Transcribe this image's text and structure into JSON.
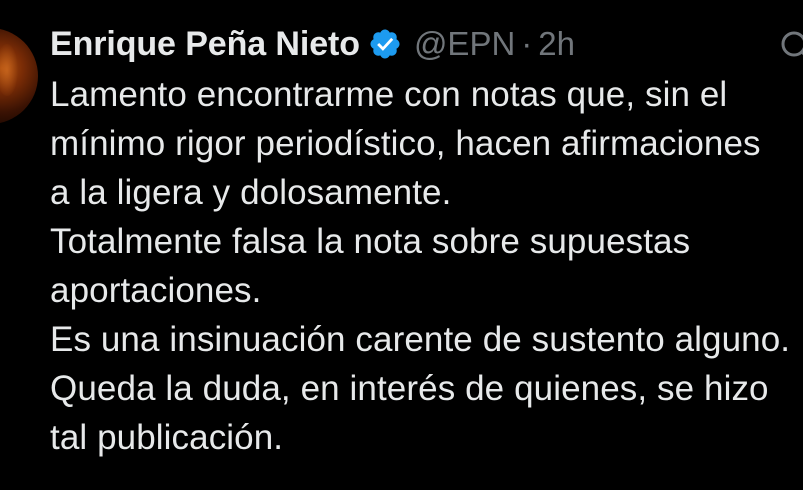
{
  "tweet": {
    "author": {
      "name": "Enrique Peña Nieto",
      "handle": "@EPN",
      "separator": "·",
      "time": "2h",
      "verified_color": "#1d9bf0"
    },
    "lines": [
      "Lamento encontrarme con notas que, sin el",
      "mínimo rigor periodístico, hacen afirmaciones",
      "a la ligera y dolosamente.",
      "Totalmente falsa la nota sobre supuestas",
      "aportaciones.",
      "Es una insinuación carente de sustento alguno.",
      "Queda la duda, en interés de quienes,  se hizo",
      "tal publicación."
    ]
  },
  "icons": {
    "verified": "verified-badge-icon",
    "search": "search-icon"
  },
  "colors": {
    "background": "#000000",
    "text": "#e7e9ea",
    "muted": "#71767b",
    "accent": "#1d9bf0"
  }
}
